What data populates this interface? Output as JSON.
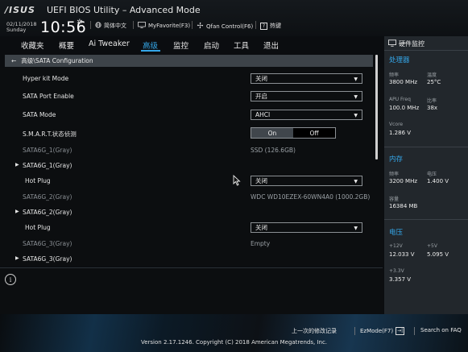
{
  "header": {
    "logo": "/ISUS",
    "title": "UEFI BIOS Utility – Advanced Mode",
    "date": "02/11/2018",
    "weekday": "Sunday",
    "time": "10:56",
    "buttons": {
      "language": "简体中文",
      "myfavorite": "MyFavorite(F3)",
      "qfan": "Qfan Control(F6)",
      "hotkeys": "热键"
    }
  },
  "nav": {
    "tabs": [
      "收藏夹",
      "概要",
      "Ai Tweaker",
      "高级",
      "监控",
      "启动",
      "工具",
      "退出"
    ],
    "active": "高级"
  },
  "breadcrumb": "高级\\SATA Configuration",
  "settings": {
    "hyper_kit_mode": {
      "label": "Hyper kit Mode",
      "value": "关闭"
    },
    "sata_port_enable": {
      "label": "SATA Port Enable",
      "value": "开启"
    },
    "sata_mode": {
      "label": "SATA Mode",
      "value": "AHCI"
    },
    "smart": {
      "label": "S.M.A.R.T.状态侦测",
      "on": "On",
      "off": "Off"
    },
    "port1_info": {
      "label": "SATA6G_1(Gray)",
      "value": "SSD (126.6GB)"
    },
    "port1_expand": {
      "label": "SATA6G_1(Gray)"
    },
    "hotplug1": {
      "label": "Hot Plug",
      "value": "关闭"
    },
    "port2_info": {
      "label": "SATA6G_2(Gray)",
      "value": "WDC WD10EZEX-60WN4A0 (1000.2GB)"
    },
    "port2_expand": {
      "label": "SATA6G_2(Gray)"
    },
    "hotplug2": {
      "label": "Hot Plug",
      "value": "关闭"
    },
    "port3_info": {
      "label": "SATA6G_3(Gray)",
      "value": "Empty"
    },
    "port3_expand": {
      "label": "SATA6G_3(Gray)"
    }
  },
  "hw_monitor": {
    "title": "硬件监控",
    "processor": {
      "heading": "处理器",
      "freq_label": "频率",
      "freq_value": "3800 MHz",
      "temp_label": "温度",
      "temp_value": "25°C",
      "apu_label": "APU Freq",
      "apu_value": "100.0 MHz",
      "ratio_label": "比率",
      "ratio_value": "38x",
      "vcore_label": "Vcore",
      "vcore_value": "1.286 V"
    },
    "memory": {
      "heading": "内存",
      "freq_label": "频率",
      "freq_value": "3200 MHz",
      "volt_label": "电压",
      "volt_value": "1.400 V",
      "cap_label": "容量",
      "cap_value": "16384 MB"
    },
    "voltage": {
      "heading": "电压",
      "v12_label": "+12V",
      "v12_value": "12.033 V",
      "v5_label": "+5V",
      "v5_value": "5.095 V",
      "v33_label": "+3.3V",
      "v33_value": "3.357 V"
    }
  },
  "footer": {
    "last_modified": "上一次的修改记录",
    "ezmode": "EzMode(F7)",
    "search": "Search on FAQ",
    "copyright": "Version 2.17.1246. Copyright (C) 2018 American Megatrends, Inc."
  },
  "colors": {
    "accent": "#34a6e8",
    "panel": "#22272c",
    "breadcrumb_bg": "#3d4349"
  }
}
